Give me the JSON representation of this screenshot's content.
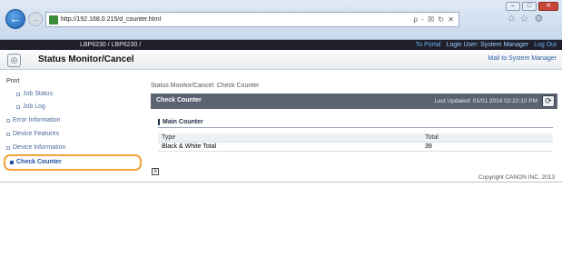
{
  "browser": {
    "url": "http://192.168.0.215/d_counter.html",
    "tools": "ρ - ☒ ↻ ✕",
    "icons": [
      "home-icon",
      "star-icon",
      "gear-icon"
    ]
  },
  "topbar": {
    "model": "LBP6230 / LBP6230 /",
    "portal": "To Portal",
    "login": "Login User: System Manager",
    "logout": "Log Out"
  },
  "header": {
    "title": "Status Monitor/Cancel",
    "mail": "Mail to System Manager"
  },
  "sidebar": {
    "section": "Print",
    "items": [
      {
        "label": "Job Status"
      },
      {
        "label": "Job Log"
      },
      {
        "label": "Error Information"
      },
      {
        "label": "Device Features"
      },
      {
        "label": "Device Information"
      },
      {
        "label": "Check Counter"
      }
    ]
  },
  "main": {
    "breadcrumb": "Status Monitor/Cancel: Check Counter",
    "panel_title": "Check Counter",
    "last_updated": "Last Updated: 01/01 2014 02:22:10 PM",
    "section_title": "Main Counter",
    "columns": [
      "Type",
      "Total"
    ],
    "rows": [
      {
        "type": "Black & White Total",
        "total": "39"
      }
    ]
  },
  "footer": {
    "copyright": "Copyright CANON INC. 2013"
  },
  "colors": {
    "highlight": "#f0a43a",
    "panel_header": "#5b6272",
    "topbar": "#1e1f2b"
  }
}
